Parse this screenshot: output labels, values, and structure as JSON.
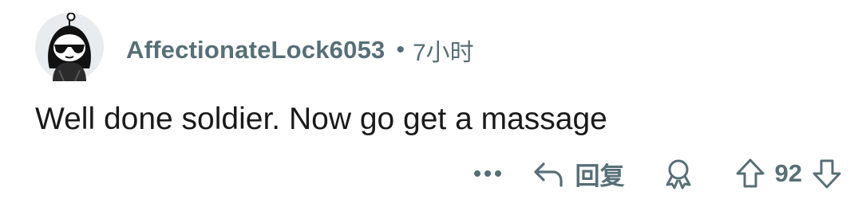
{
  "comment": {
    "author": "AffectionateLock6053",
    "separator": "•",
    "timestamp": "7小时",
    "body": "Well done soldier. Now go get a massage"
  },
  "actions": {
    "more_icon": "more-horizontal-icon",
    "reply_icon": "reply-arrow-icon",
    "reply_label": "回复",
    "award_icon": "award-icon",
    "upvote_icon": "upvote-arrow-icon",
    "score": "92",
    "downvote_icon": "downvote-arrow-icon"
  },
  "colors": {
    "meta_text": "#576f76",
    "body_text": "#1a1a1b",
    "avatar_bg": "#e9ecee",
    "avatar_dark": "#111111"
  }
}
